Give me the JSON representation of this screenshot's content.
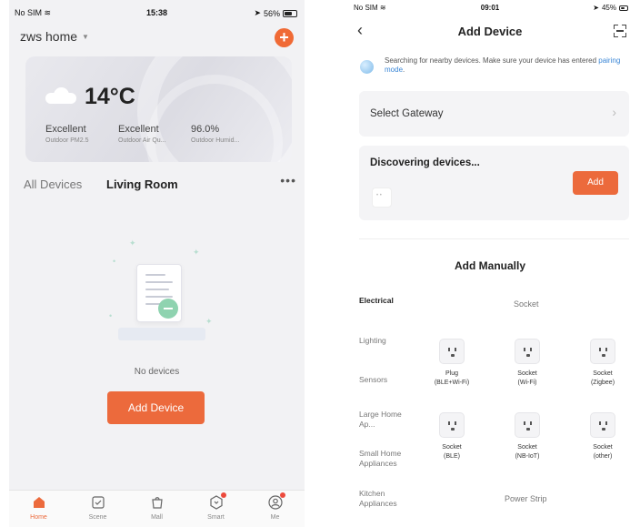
{
  "left": {
    "status": {
      "carrier": "No SIM",
      "time": "15:38",
      "battery": "56%"
    },
    "home_name": "zws home",
    "weather": {
      "temperature": "14°C",
      "stats": [
        {
          "value": "Excellent",
          "label": "Outdoor PM2.5"
        },
        {
          "value": "Excellent",
          "label": "Outdoor Air Qu..."
        },
        {
          "value": "96.0%",
          "label": "Outdoor Humid..."
        }
      ]
    },
    "tabs": {
      "all": "All Devices",
      "room": "Living Room",
      "more": "•••"
    },
    "empty_text": "No devices",
    "add_device": "Add Device",
    "nav": [
      {
        "label": "Home",
        "icon": "home-icon",
        "active": true
      },
      {
        "label": "Scene",
        "icon": "scene-icon"
      },
      {
        "label": "Mall",
        "icon": "mall-icon"
      },
      {
        "label": "Smart",
        "icon": "smart-icon"
      },
      {
        "label": "Me",
        "icon": "me-icon"
      }
    ],
    "accent": "#ec6a3c"
  },
  "right": {
    "status": {
      "carrier": "No SIM",
      "time": "09:01",
      "battery": "45%"
    },
    "title": "Add Device",
    "search_note": "Searching for nearby devices. Make sure your device has entered",
    "search_link": "pairing mode",
    "search_end": ".",
    "gateway": "Select Gateway",
    "discovering": "Discovering devices...",
    "add": "Add",
    "manual_title": "Add Manually",
    "categories": [
      "Electrical",
      "Lighting",
      "Sensors",
      "Large Home Ap...",
      "Small Home Appliances",
      "Kitchen Appliances"
    ],
    "socket_section": "Socket",
    "power_strip_section": "Power Strip",
    "devices": [
      {
        "line1": "Plug",
        "line2": "(BLE+Wi-Fi)"
      },
      {
        "line1": "Socket",
        "line2": "(Wi-Fi)"
      },
      {
        "line1": "Socket",
        "line2": "(Zigbee)"
      },
      {
        "line1": "Socket",
        "line2": "(BLE)"
      },
      {
        "line1": "Socket",
        "line2": "(NB-IoT)"
      },
      {
        "line1": "Socket",
        "line2": "(other)"
      }
    ]
  }
}
